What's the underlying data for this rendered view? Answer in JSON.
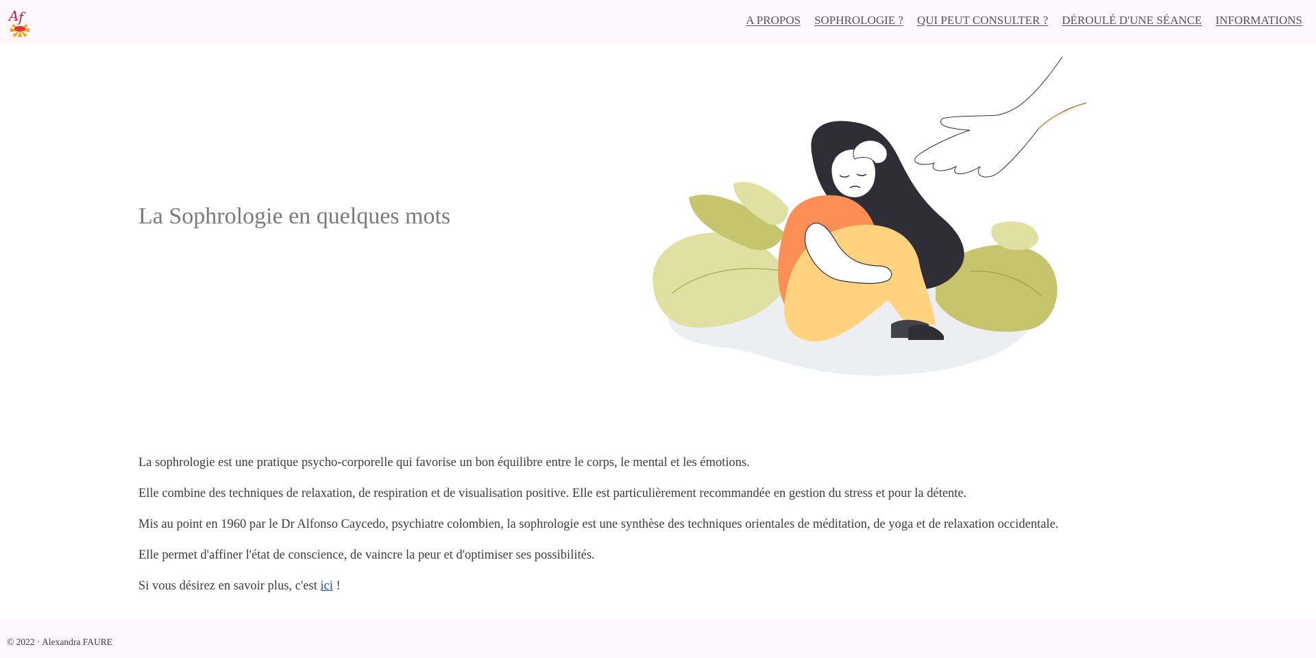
{
  "header": {
    "logo_icon": "af-sunflower-logo-icon",
    "nav": [
      {
        "label": "A PROPOS"
      },
      {
        "label": "SOPHROLOGIE ?"
      },
      {
        "label": "QUI PEUT CONSULTER ?"
      },
      {
        "label": "DÉROULÉ D'UNE SÉANCE"
      },
      {
        "label": "INFORMATIONS"
      }
    ]
  },
  "hero": {
    "title": "La Sophrologie en quelques mots",
    "illustration_icon": "woman-hugging-knees-with-helping-hand-illustration"
  },
  "content": {
    "paragraphs": [
      "La sophrologie est une pratique psycho-corporelle qui favorise un bon équilibre entre le corps, le mental et les émotions.",
      "Elle combine des techniques de relaxation, de respiration et de visualisation positive. Elle est particulièrement recommandée en gestion du stress et pour la détente.",
      "Mis au point en 1960 par le Dr Alfonso Caycedo, psychiatre colombien, la sophrologie est une synthèse des techniques orientales de méditation, de yoga et de relaxation occidentale.",
      "Elle permet d'affiner l'état de conscience, de vaincre la peur et d'optimiser ses possibilités."
    ],
    "more_prefix": "Si vous désirez en savoir plus, c'est ",
    "more_link": "ici",
    "more_suffix": " !"
  },
  "footer": {
    "copyright": "© 2022 · Alexandra FAURE"
  },
  "colors": {
    "header_bg": "#fdf7fc",
    "link_blue": "#1a44c9",
    "title_grey": "#7a7a7a",
    "leaf_green": "#c6c46c",
    "leaf_light": "#dfe0a2",
    "shirt_orange": "#fb8f55",
    "pants_yellow": "#fed27e",
    "hair_dark": "#2f2e36"
  }
}
